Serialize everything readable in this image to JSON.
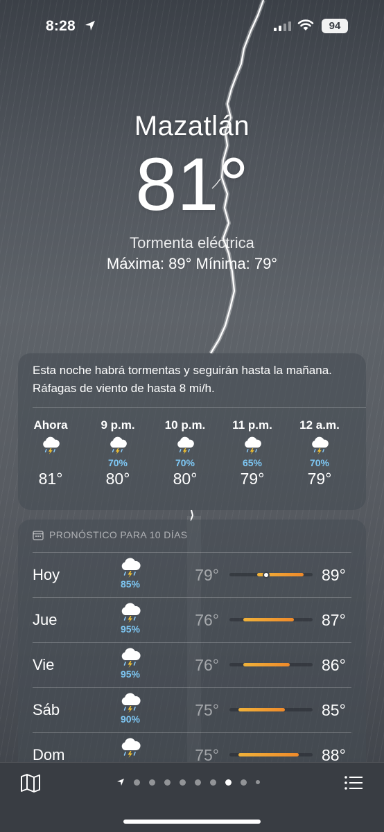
{
  "status_bar": {
    "time": "8:28",
    "battery": "94"
  },
  "current": {
    "city": "Mazatlán",
    "temperature": "81°",
    "condition": "Tormenta eléctrica",
    "hi_lo": "Máxima: 89°  Mínima: 79°"
  },
  "hourly": {
    "summary": "Esta noche habrá tormentas y seguirán hasta la mañana. Ráfagas de viento de hasta 8 mi/h.",
    "items": [
      {
        "time": "Ahora",
        "icon": "thunderstorm-icon",
        "precip": "",
        "temp": "81°"
      },
      {
        "time": "9 p.m.",
        "icon": "thunderstorm-icon",
        "precip": "70%",
        "temp": "80°"
      },
      {
        "time": "10 p.m.",
        "icon": "thunderstorm-icon",
        "precip": "70%",
        "temp": "80°"
      },
      {
        "time": "11 p.m.",
        "icon": "thunderstorm-icon",
        "precip": "65%",
        "temp": "79°"
      },
      {
        "time": "12 a.m.",
        "icon": "thunderstorm-icon",
        "precip": "70%",
        "temp": "79°"
      }
    ]
  },
  "daily": {
    "header": "PRONÓSTICO PARA 10 DÍAS",
    "range_min": 73,
    "range_max": 91,
    "days": [
      {
        "day": "Hoy",
        "icon": "thunderstorm-icon",
        "precip": "85%",
        "low": "79°",
        "high": "89°",
        "low_value": 79,
        "high_value": 89,
        "current_value": 81
      },
      {
        "day": "Jue",
        "icon": "thunderstorm-icon",
        "precip": "95%",
        "low": "76°",
        "high": "87°",
        "low_value": 76,
        "high_value": 87
      },
      {
        "day": "Vie",
        "icon": "thunderstorm-icon",
        "precip": "95%",
        "low": "76°",
        "high": "86°",
        "low_value": 76,
        "high_value": 86
      },
      {
        "day": "Sáb",
        "icon": "thunderstorm-icon",
        "precip": "90%",
        "low": "75°",
        "high": "85°",
        "low_value": 75,
        "high_value": 85
      },
      {
        "day": "Dom",
        "icon": "thunderstorm-icon",
        "precip": "",
        "low": "75°",
        "high": "88°",
        "low_value": 75,
        "high_value": 88
      }
    ]
  },
  "pager": {
    "pages": 10,
    "active_index": 7
  },
  "colors": {
    "precip": "#7ec8f5",
    "bar_start": "#f0b23a",
    "bar_end": "#ef8a2a"
  }
}
